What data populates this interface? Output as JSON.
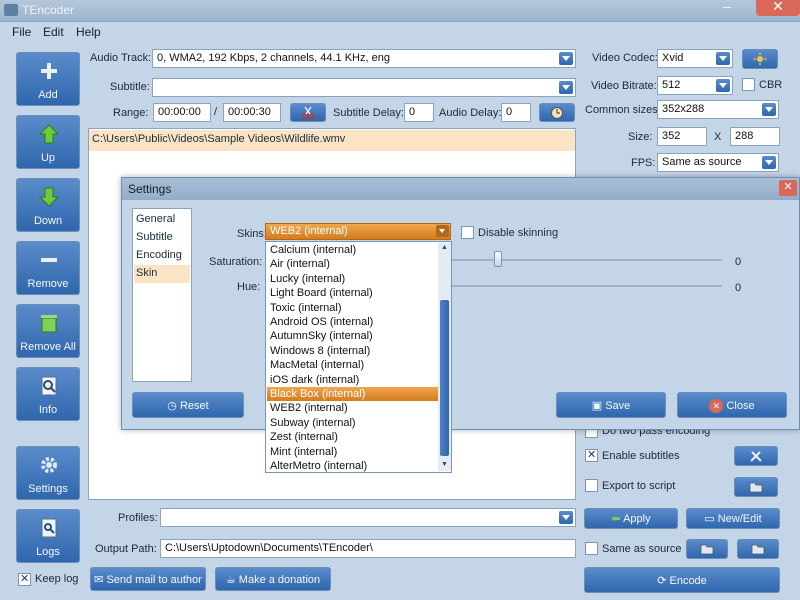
{
  "window": {
    "title": "TEncoder",
    "minimize": "–",
    "close": "✕"
  },
  "menu": [
    "File",
    "Edit",
    "Help"
  ],
  "sidebar": [
    {
      "label": "Add",
      "icon": "plus-icon"
    },
    {
      "label": "Up",
      "icon": "arrow-up-icon"
    },
    {
      "label": "Down",
      "icon": "arrow-down-icon"
    },
    {
      "label": "Remove",
      "icon": "minus-icon"
    },
    {
      "label": "Remove All",
      "icon": "trash-icon"
    },
    {
      "label": "Info",
      "icon": "info-icon"
    },
    {
      "label": "Settings",
      "icon": "gear-icon"
    },
    {
      "label": "Logs",
      "icon": "logs-icon"
    }
  ],
  "keep_log": {
    "label": "Keep log",
    "checked": true
  },
  "audio_track": {
    "label": "Audio Track:",
    "value": "0, WMA2, 192 Kbps, 2 channels, 44.1 KHz, eng"
  },
  "subtitle": {
    "label": "Subtitle:",
    "value": ""
  },
  "range": {
    "label": "Range:",
    "start": "00:00:00",
    "sep": "/",
    "end": "00:00:30"
  },
  "subtitle_delay": {
    "label": "Subtitle Delay:",
    "value": "0"
  },
  "audio_delay": {
    "label": "Audio Delay:",
    "value": "0"
  },
  "file_list": [
    "C:\\Users\\Public\\Videos\\Sample Videos\\Wildlife.wmv"
  ],
  "video_codec": {
    "label": "Video Codec:",
    "value": "Xvid"
  },
  "video_bitrate": {
    "label": "Video Bitrate:",
    "value": "512",
    "cbr_label": "CBR"
  },
  "common_sizes": {
    "label": "Common sizes:",
    "value": "352x288"
  },
  "size": {
    "label": "Size:",
    "width": "352",
    "x": "X",
    "height": "288"
  },
  "fps": {
    "label": "FPS:",
    "value": "Same as source"
  },
  "two_pass": {
    "label": "Do two pass encoding"
  },
  "enable_subtitles": {
    "label": "Enable subtitles",
    "checked": true
  },
  "export_script": {
    "label": "Export to script"
  },
  "profiles": {
    "label": "Profiles:",
    "value": "",
    "apply_label": "Apply",
    "new_edit_label": "New/Edit"
  },
  "output_path": {
    "label": "Output Path:",
    "value": "C:\\Users\\Uptodown\\Documents\\TEncoder\\",
    "same_as_source": "Same as source"
  },
  "bottom": {
    "send_mail": "Send mail to author",
    "donation": "Make a donation",
    "encode": "Encode"
  },
  "settings_dialog": {
    "title": "Settings",
    "close": "✕",
    "nav": [
      "General",
      "Subtitle",
      "Encoding",
      "Skin"
    ],
    "nav_selected": 3,
    "skins_label": "Skins:",
    "skins_value": "WEB2 (internal)",
    "disable_skinning": "Disable skinning",
    "saturation_label": "Saturation:",
    "saturation_value": "0",
    "hue_label": "Hue:",
    "hue_value": "0",
    "reset": "Reset",
    "save": "Save",
    "close_btn": "Close",
    "skin_options": [
      "Calcium (internal)",
      "Air (internal)",
      "Lucky (internal)",
      "Light Board (internal)",
      "Toxic (internal)",
      "Android OS (internal)",
      "AutumnSky (internal)",
      "Windows 8 (internal)",
      "MacMetal (internal)",
      "iOS dark (internal)",
      "Black Box (internal)",
      "WEB2 (internal)",
      "Subway (internal)",
      "Zest (internal)",
      "Mint (internal)",
      "AlterMetro (internal)"
    ],
    "skin_selected": 10
  }
}
